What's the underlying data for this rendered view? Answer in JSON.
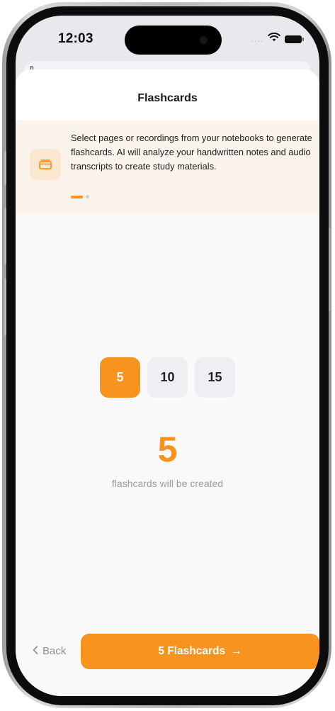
{
  "status_bar": {
    "time": "12:03",
    "signal": "....",
    "icons": [
      "signal-dots-icon",
      "wifi-icon",
      "battery-icon"
    ]
  },
  "sheet": {
    "title": "Flashcards"
  },
  "info_banner": {
    "icon": "folder-icon",
    "text": "Select pages or recordings from your notebooks to generate flashcards. AI will analyze your handwritten notes and audio transcripts to create study materials.",
    "pages": 2,
    "current_page": 1
  },
  "count_selector": {
    "options": [
      "5",
      "10",
      "15"
    ],
    "selected": "5",
    "big_value": "5",
    "caption": "flashcards will be created"
  },
  "footer": {
    "back_label": "Back",
    "primary_label": "5 Flashcards",
    "primary_arrow": "→"
  },
  "colors": {
    "accent": "#f7931e",
    "banner_bg": "#faf4ec",
    "option_bg": "#efeff3",
    "caption": "#9b9ba0"
  }
}
